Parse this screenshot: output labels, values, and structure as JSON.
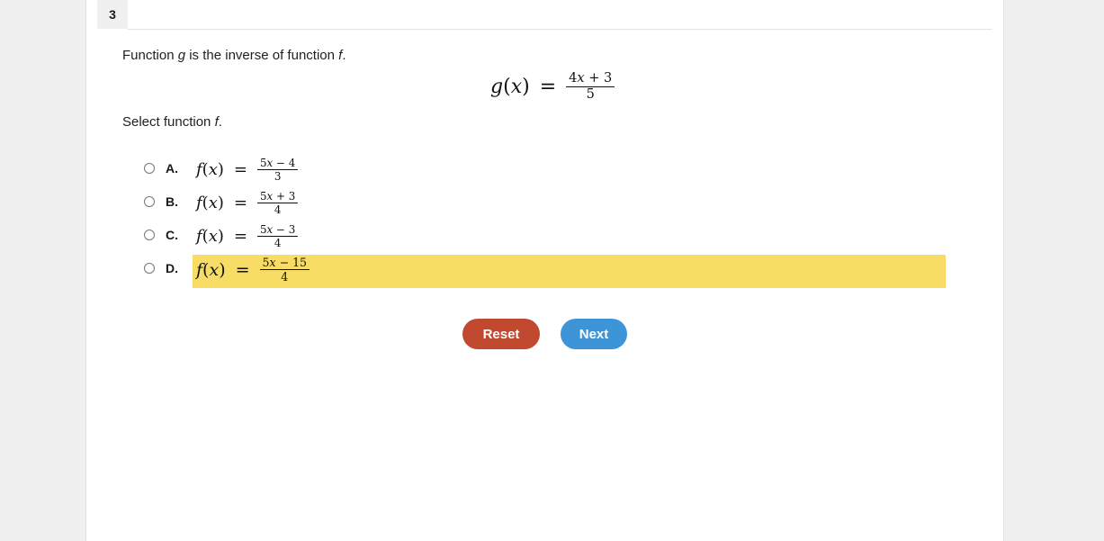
{
  "colors": {
    "page_background": "#f0f0f0",
    "panel_background": "#ffffff",
    "highlight": "#f7dd65",
    "reset_button": "#c0492f",
    "next_button": "#3d95d8"
  },
  "tab": {
    "question_number": "3"
  },
  "prompt": {
    "line1_before": "Function ",
    "line1_var": "g",
    "line1_middle": " is the inverse of function ",
    "line1_var2": "f",
    "line1_after": ".",
    "line2_before": "Select function ",
    "line2_var": "f",
    "line2_after": "."
  },
  "display_equation": {
    "lhs_fn": "g",
    "lhs_open": "(",
    "lhs_arg": "x",
    "lhs_close": ")",
    "equals": "=",
    "numerator_coeff": "4",
    "numerator_var": "x",
    "numerator_op": "+",
    "numerator_const": "3",
    "denominator": "5"
  },
  "choices": [
    {
      "letter": "A.",
      "fn": "f",
      "open": "(",
      "arg": "x",
      "close": ")",
      "equals": "=",
      "numerator_coeff": "5",
      "numerator_var": "x",
      "numerator_op": "−",
      "numerator_const": "4",
      "denominator": "3",
      "selected": false,
      "highlighted": false
    },
    {
      "letter": "B.",
      "fn": "f",
      "open": "(",
      "arg": "x",
      "close": ")",
      "equals": "=",
      "numerator_coeff": "5",
      "numerator_var": "x",
      "numerator_op": "+",
      "numerator_const": "3",
      "denominator": "4",
      "selected": false,
      "highlighted": false
    },
    {
      "letter": "C.",
      "fn": "f",
      "open": "(",
      "arg": "x",
      "close": ")",
      "equals": "=",
      "numerator_coeff": "5",
      "numerator_var": "x",
      "numerator_op": "−",
      "numerator_const": "3",
      "denominator": "4",
      "selected": false,
      "highlighted": false
    },
    {
      "letter": "D.",
      "fn": "f",
      "open": "(",
      "arg": "x",
      "close": ")",
      "equals": "=",
      "numerator_coeff": "5",
      "numerator_var": "x",
      "numerator_op": "−",
      "numerator_const": "15",
      "denominator": "4",
      "selected": false,
      "highlighted": true
    }
  ],
  "buttons": {
    "reset_label": "Reset",
    "next_label": "Next"
  }
}
